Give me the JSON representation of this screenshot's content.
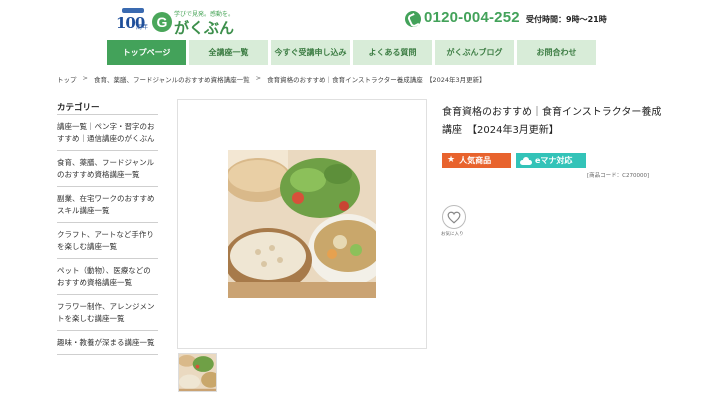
{
  "header": {
    "anniversary": {
      "number": "100",
      "suffix": "周年"
    },
    "logo": {
      "tagline": "学びで見発。感動を。",
      "name": "がくぶん",
      "mark": "G"
    },
    "phone": "0120-004-252",
    "hours": "受付時間：9時〜21時"
  },
  "nav": [
    {
      "label": "トップページ",
      "active": true
    },
    {
      "label": "全講座一覧"
    },
    {
      "label": "今すぐ受講申し込み"
    },
    {
      "label": "よくある質問"
    },
    {
      "label": "がくぶんブログ"
    },
    {
      "label": "お問合わせ"
    }
  ],
  "breadcrumb": [
    "トップ",
    "食育、薬膳、フードジャンルのおすすめ資格講座一覧",
    "食育資格のおすすめ｜食育インストラクター養成講座　【2024年3月更新】"
  ],
  "sidebar": {
    "title": "カテゴリー",
    "items": [
      "講座一覧｜ペン字・習字のおすすめ｜通信講座のがくぶん",
      "食育、薬膳、フードジャンルのおすすめ資格講座一覧",
      "副業、在宅ワークのおすすめスキル講座一覧",
      "クラフト、アートなど手作りを楽しむ講座一覧",
      "ペット（動物）、医療などのおすすめ資格講座一覧",
      "フラワー制作、アレンジメントを楽しむ講座一覧",
      "趣味・教養が深まる講座一覧"
    ]
  },
  "product": {
    "title": "食育資格のおすすめ｜食育インストラクター養成講座　【2024年3月更新】",
    "badge_popular": "人気商品",
    "badge_emana": "eマナ対応",
    "code": "[商品コード：C270000]",
    "fav_label": "お気に入り"
  },
  "colors": {
    "brand_green": "#43a25a",
    "nav_light": "#d8ecd8",
    "popular_orange": "#e8632d",
    "emana_teal": "#33c3b8"
  }
}
